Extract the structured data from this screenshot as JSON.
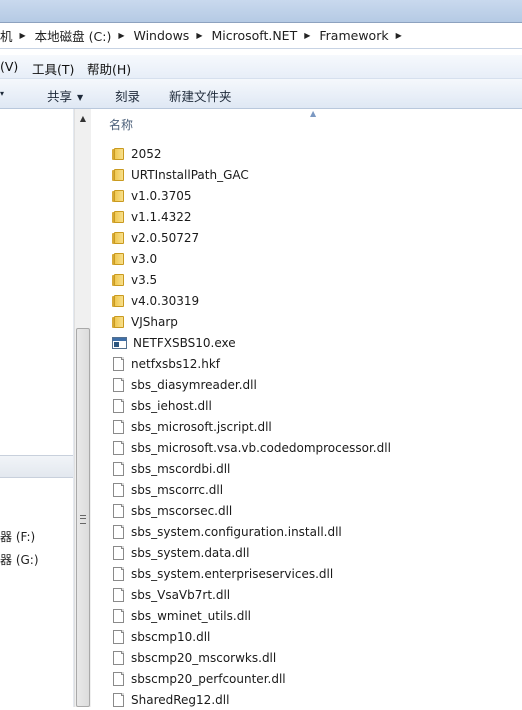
{
  "address": {
    "crumbs": [
      "机",
      "本地磁盘 (C:)",
      "Windows",
      "Microsoft.NET",
      "Framework"
    ]
  },
  "menu": {
    "items": [
      "(V)",
      "工具(T)",
      "帮助(H)"
    ]
  },
  "toolbar": {
    "left_fragment": "▾",
    "share_label": "共享",
    "burn_label": "刻录",
    "new_folder_label": "新建文件夹"
  },
  "nav": {
    "drives": [
      "器 (F:)",
      "器 (G:)"
    ]
  },
  "filelist": {
    "column_name": "名称",
    "items": [
      {
        "name": "2052",
        "type": "folder"
      },
      {
        "name": "URTInstallPath_GAC",
        "type": "folder"
      },
      {
        "name": "v1.0.3705",
        "type": "folder"
      },
      {
        "name": "v1.1.4322",
        "type": "folder"
      },
      {
        "name": "v2.0.50727",
        "type": "folder"
      },
      {
        "name": "v3.0",
        "type": "folder"
      },
      {
        "name": "v3.5",
        "type": "folder"
      },
      {
        "name": "v4.0.30319",
        "type": "folder"
      },
      {
        "name": "VJSharp",
        "type": "folder"
      },
      {
        "name": "NETFXSBS10.exe",
        "type": "exe"
      },
      {
        "name": "netfxsbs12.hkf",
        "type": "file"
      },
      {
        "name": "sbs_diasymreader.dll",
        "type": "file"
      },
      {
        "name": "sbs_iehost.dll",
        "type": "file"
      },
      {
        "name": "sbs_microsoft.jscript.dll",
        "type": "file"
      },
      {
        "name": "sbs_microsoft.vsa.vb.codedomprocessor.dll",
        "type": "file"
      },
      {
        "name": "sbs_mscordbi.dll",
        "type": "file"
      },
      {
        "name": "sbs_mscorrc.dll",
        "type": "file"
      },
      {
        "name": "sbs_mscorsec.dll",
        "type": "file"
      },
      {
        "name": "sbs_system.configuration.install.dll",
        "type": "file"
      },
      {
        "name": "sbs_system.data.dll",
        "type": "file"
      },
      {
        "name": "sbs_system.enterpriseservices.dll",
        "type": "file"
      },
      {
        "name": "sbs_VsaVb7rt.dll",
        "type": "file"
      },
      {
        "name": "sbs_wminet_utils.dll",
        "type": "file"
      },
      {
        "name": "sbscmp10.dll",
        "type": "file"
      },
      {
        "name": "sbscmp20_mscorwks.dll",
        "type": "file"
      },
      {
        "name": "sbscmp20_perfcounter.dll",
        "type": "file"
      },
      {
        "name": "SharedReg12.dll",
        "type": "file"
      }
    ]
  }
}
